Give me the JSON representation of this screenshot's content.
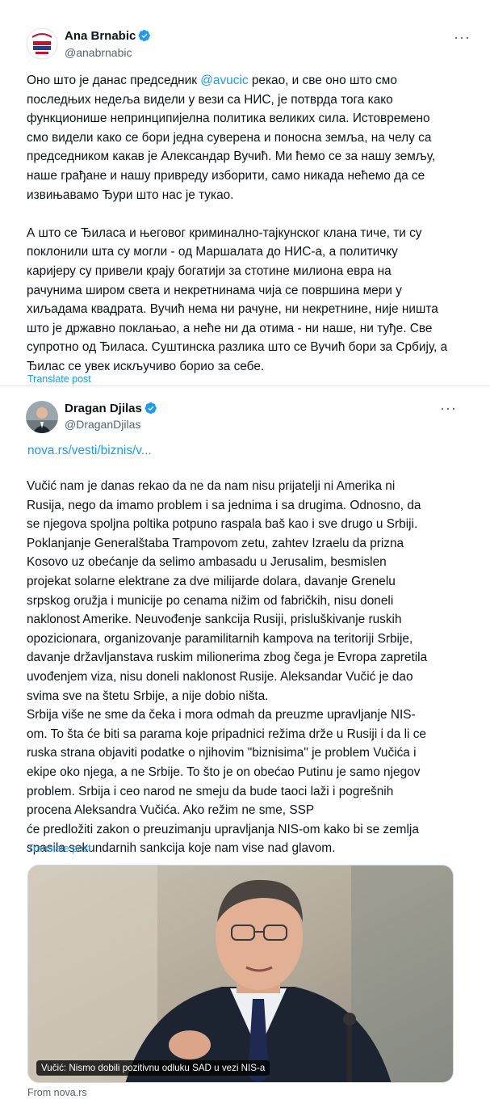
{
  "tweets": [
    {
      "author": "Ana Brnabic",
      "handle": "@anabrnabic",
      "avatar_text": "СРПСКА СЛОГА",
      "more_label": "···",
      "lines": [
        [
          "Оно што је данас председник ",
          "@avucic",
          " рекао, и све оно што смо"
        ],
        [
          "последњих недеља видели у вези са НИС, је потврда тога како"
        ],
        [
          "функционише непринципијелна политика великих сила. Истовремено"
        ],
        [
          "смо видели како се бори једна суверена и поносна земља, на челу са"
        ],
        [
          "председником какав је Александар Вучић. Ми ћемо се за нашу земљу,"
        ],
        [
          "наше грађане и нашу привреду изборити, само никада нећемо да се"
        ],
        [
          "извињавамо Ђури што нас је тукао."
        ],
        [
          ""
        ],
        [
          "А што се Ђиласа и његовог криминално-тајкунског клана тиче, ти су"
        ],
        [
          "поклонили шта су могли - од Маршалата до НИС-а, а политичку"
        ],
        [
          "каријеру су привели крају богатији за стотине милиона евра на"
        ],
        [
          "рачунима широм света и некретнинама чија се површина мери у"
        ],
        [
          "хиљадама квадрата. Вучић нема ни рачуне, ни некретнине, није ништа"
        ],
        [
          "што је државно поклањао, а неће ни да отима - ни наше, ни туђе. Све"
        ],
        [
          "супротно од Ђиласа. Суштинска разлика што се Вучић бори за Србију, а"
        ],
        [
          "Ђилас се увек искључиво борио за себе."
        ]
      ],
      "translate": "Translate post"
    },
    {
      "author": "Dragan Djilas",
      "handle": "@DraganDjilas",
      "more_label": "···",
      "link": "nova.rs/vesti/biznis/v...",
      "lines": [
        [
          "Vučić nam je danas rekao da ne da nam nisu prijatelji ni Amerika ni"
        ],
        [
          "Rusija, nego da imamo problem i sa jednima i sa drugima. Odnosno,  da"
        ],
        [
          "se njegova spoljna poltika potpuno raspala baš kao i sve drugo u Srbiji."
        ],
        [
          "Poklanjanje Generalštaba Trampovom zetu, zahtev Izraelu da prizna"
        ],
        [
          "Kosovo uz obećanje da selimo ambasadu u Jerusalim, besmislen"
        ],
        [
          "projekat solarne elektrane za dve milijarde dolara, davanje Grenelu"
        ],
        [
          "srpskog oružja i municije po cenama nižim od fabričkih, nisu doneli"
        ],
        [
          "naklonost Amerike. Neuvođenje sankcija Rusiji, prisluškivanje ruskih"
        ],
        [
          "opozicionara, organizovanje paramilitarnih kampova na teritoriji Srbije,"
        ],
        [
          "davanje državljanstava ruskim milionerima zbog čega je Evropa zapretila"
        ],
        [
          "uvođenjem viza, nisu doneli naklonost Rusije. Aleksandar Vučić je dao"
        ],
        [
          "svima sve na štetu Srbije, a nije dobio ništa."
        ],
        [
          "Srbija više ne sme da čeka i mora odmah da preuzme upravljanje NIS-"
        ],
        [
          "om. To šta će biti sa parama koje pripadnici režima drže u Rusiji i da li ce"
        ],
        [
          "ruska strana objaviti podatke o njihovim \"biznisima\" je problem Vučića i"
        ],
        [
          "ekipe oko njega, a ne Srbije. To što je on obećao Putinu je samo njegov"
        ],
        [
          "problem. Srbija i ceo narod ne smeju da bude taoci laži i pogrešnih"
        ],
        [
          "procena Aleksandra Vučića. Ako režim ne sme,  SSP"
        ],
        [
          "će predložiti zakon o preuzimanju upravljanja NIS-om kako bi se zemlja"
        ],
        [
          "spasila sekundarnih sankcija koje nam vise nad glavom."
        ]
      ],
      "translate": "Translate post",
      "media_caption": "Vučić: Nismo dobili pozitivnu odluku SAD u vezi NIS-a",
      "source": "From nova.rs"
    }
  ],
  "colors": {
    "accent": "#1d9bf0",
    "text": "#0f1419",
    "muted": "#536471"
  }
}
